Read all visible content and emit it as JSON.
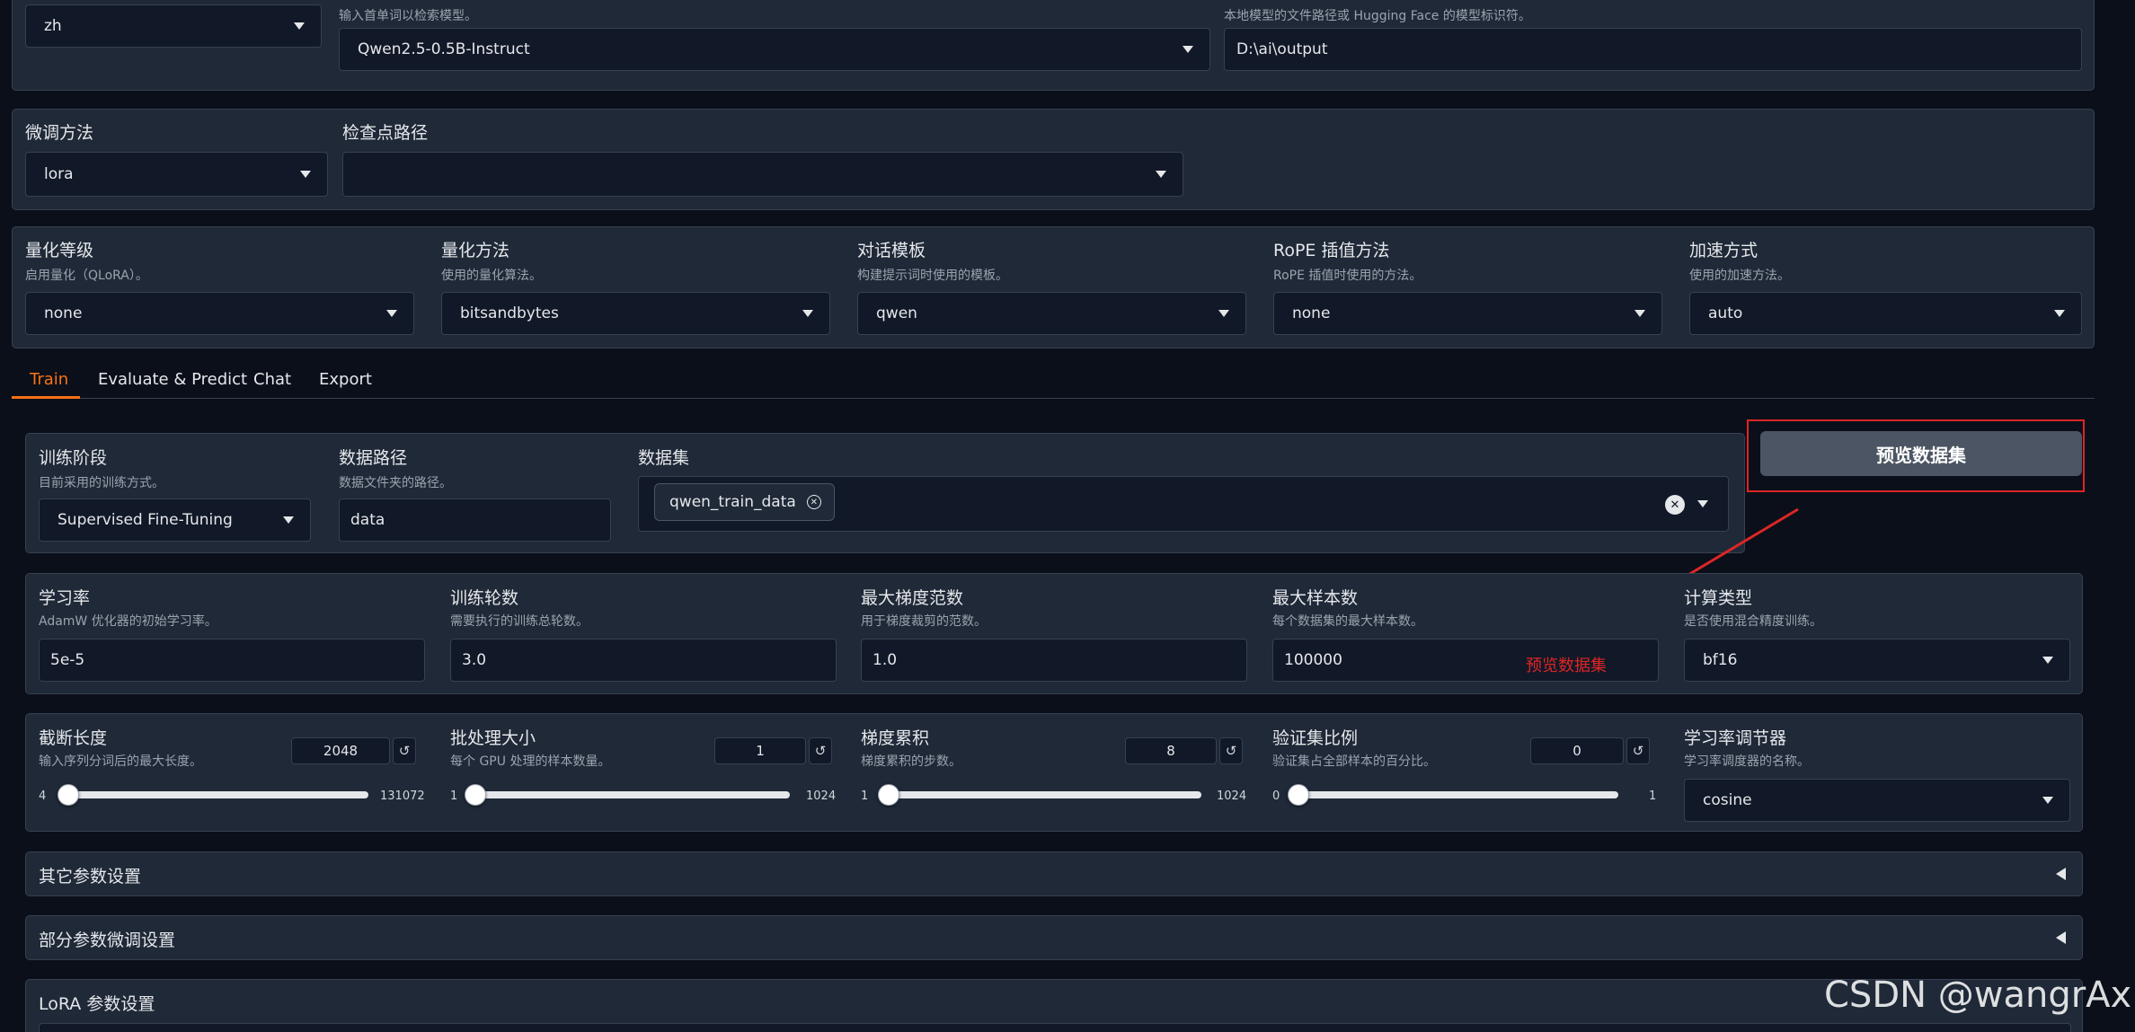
{
  "top": {
    "lang_value": "zh",
    "model_info": "输入首单词以检索模型。",
    "model_value": "Qwen2.5-0.5B-Instruct",
    "path_info": "本地模型的文件路径或 Hugging Face 的模型标识符。",
    "path_value": "D:\\ai\\output"
  },
  "finetune": {
    "method_label": "微调方法",
    "method_value": "lora",
    "checkpoint_label": "检查点路径",
    "checkpoint_value": ""
  },
  "quant": [
    {
      "label": "量化等级",
      "info": "启用量化（QLoRA）。",
      "value": "none"
    },
    {
      "label": "量化方法",
      "info": "使用的量化算法。",
      "value": "bitsandbytes"
    },
    {
      "label": "对话模板",
      "info": "构建提示词时使用的模板。",
      "value": "qwen"
    },
    {
      "label": "RoPE 插值方法",
      "info": "RoPE 插值时使用的方法。",
      "value": "none"
    },
    {
      "label": "加速方式",
      "info": "使用的加速方法。",
      "value": "auto"
    }
  ],
  "tabs": [
    "Train",
    "Evaluate & Predict",
    "Chat",
    "Export"
  ],
  "train": {
    "stage_label": "训练阶段",
    "stage_info": "目前采用的训练方式。",
    "stage_value": "Supervised Fine-Tuning",
    "datadir_label": "数据路径",
    "datadir_info": "数据文件夹的路径。",
    "datadir_value": "data",
    "dataset_label": "数据集",
    "dataset_chip": "qwen_train_data",
    "preview_button": "预览数据集",
    "annotation": "预览数据集"
  },
  "hparams": [
    {
      "label": "学习率",
      "info": "AdamW 优化器的初始学习率。",
      "value": "5e-5"
    },
    {
      "label": "训练轮数",
      "info": "需要执行的训练总轮数。",
      "value": "3.0"
    },
    {
      "label": "最大梯度范数",
      "info": "用于梯度裁剪的范数。",
      "value": "1.0"
    },
    {
      "label": "最大样本数",
      "info": "每个数据集的最大样本数。",
      "value": "100000"
    },
    {
      "label": "计算类型",
      "info": "是否使用混合精度训练。",
      "value": "bf16"
    }
  ],
  "sliders": [
    {
      "label": "截断长度",
      "info": "输入序列分词后的最大长度。",
      "value": "2048",
      "min": "4",
      "max": "131072",
      "fraction": 0.0156
    },
    {
      "label": "批处理大小",
      "info": "每个 GPU 处理的样本数量。",
      "value": "1",
      "min": "1",
      "max": "1024",
      "fraction": 0.0
    },
    {
      "label": "梯度累积",
      "info": "梯度累积的步数。",
      "value": "8",
      "min": "1",
      "max": "1024",
      "fraction": 0.0068
    },
    {
      "label": "验证集比例",
      "info": "验证集占全部样本的百分比。",
      "value": "0",
      "min": "0",
      "max": "1",
      "fraction": 0.0
    }
  ],
  "scheduler": {
    "label": "学习率调节器",
    "info": "学习率调度器的名称。",
    "value": "cosine"
  },
  "accordions": [
    "其它参数设置",
    "部分参数微调设置",
    "LoRA 参数设置"
  ],
  "watermark": "CSDN @wangrAx",
  "colors": {
    "accent": "#f97316",
    "highlight": "#dc2626",
    "background": "#0b0f19",
    "panel": "#1f2937"
  }
}
